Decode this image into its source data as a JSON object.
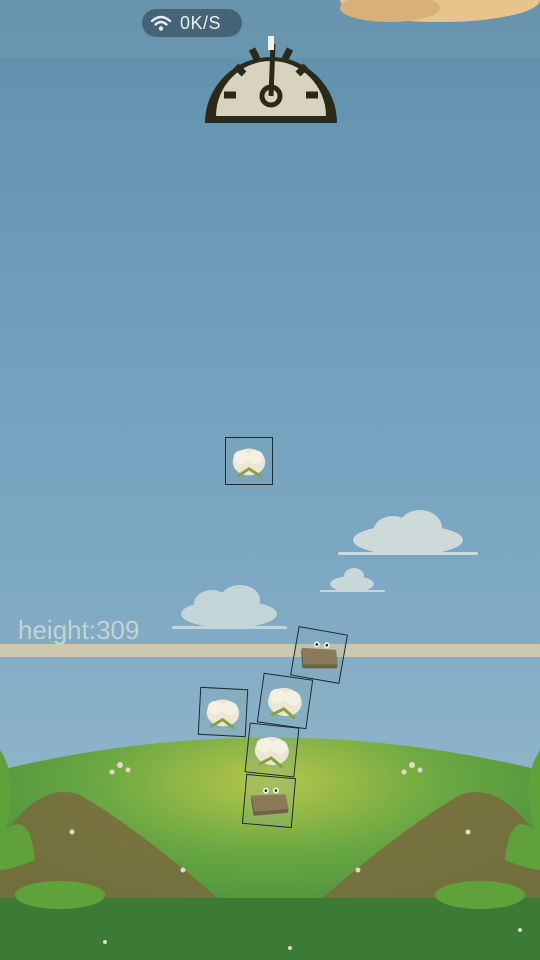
{
  "status_bar": {
    "network_speed": "0K/S",
    "wifi_icon": "wifi-icon"
  },
  "hud": {
    "gauge_icon": "speedometer-gauge-icon",
    "height_label": "height:309"
  },
  "colors": {
    "sky": "#6f9ebc",
    "grass": "#4f9b3c",
    "height_line": "#dccdaa",
    "gauge_face": "#d8d3bf",
    "gauge_dark": "#2b2a1a"
  },
  "blocks": [
    {
      "kind": "cotton-block",
      "state": "falling"
    },
    {
      "kind": "brick-block",
      "state": "stacked"
    },
    {
      "kind": "cotton-block",
      "state": "stacked"
    },
    {
      "kind": "cotton-block",
      "state": "stacked"
    },
    {
      "kind": "cotton-block",
      "state": "stacked"
    },
    {
      "kind": "brick-block",
      "state": "stacked"
    }
  ]
}
